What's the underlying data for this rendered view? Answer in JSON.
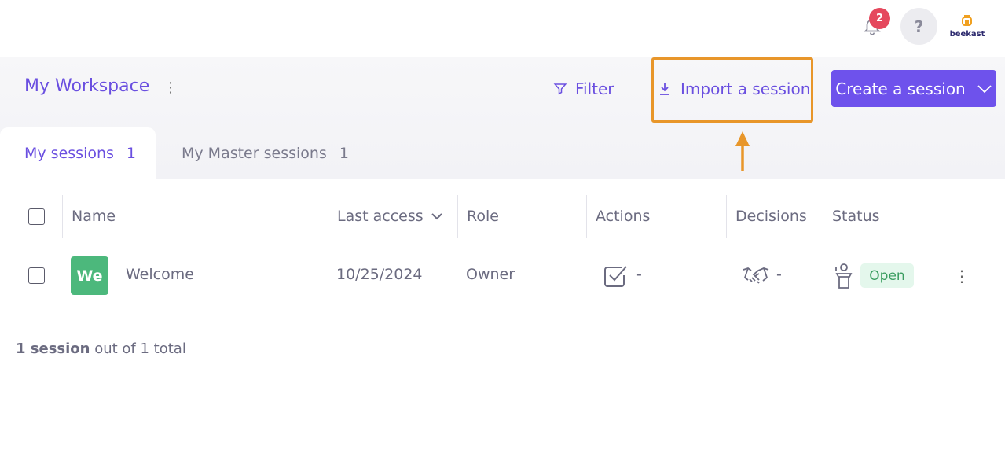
{
  "topbar": {
    "notification_count": "2",
    "help_label": "?",
    "logo_text": "beekast"
  },
  "header": {
    "workspace_title": "My Workspace",
    "workspace_menu": "⋮",
    "filter_label": "Filter",
    "import_label": "Import a session",
    "create_label": "Create a session"
  },
  "tabs": [
    {
      "label": "My sessions",
      "count": "1"
    },
    {
      "label": "My Master sessions",
      "count": "1"
    }
  ],
  "table": {
    "columns": {
      "name": "Name",
      "last_access": "Last access",
      "role": "Role",
      "actions": "Actions",
      "decisions": "Decisions",
      "status": "Status"
    },
    "rows": [
      {
        "avatar": "We",
        "name": "Welcome",
        "last_access": "10/25/2024",
        "role": "Owner",
        "actions": "-",
        "decisions": "-",
        "status": "Open",
        "menu": "⋮"
      }
    ]
  },
  "footer": {
    "count_bold": "1 session",
    "count_rest": " out of 1 total"
  },
  "colors": {
    "accent": "#6a4fe0",
    "primary_button": "#6e52ec",
    "highlight": "#e8962a",
    "badge": "#e5485d",
    "avatar": "#4cb87c",
    "status_open_bg": "#e4f7ec"
  }
}
